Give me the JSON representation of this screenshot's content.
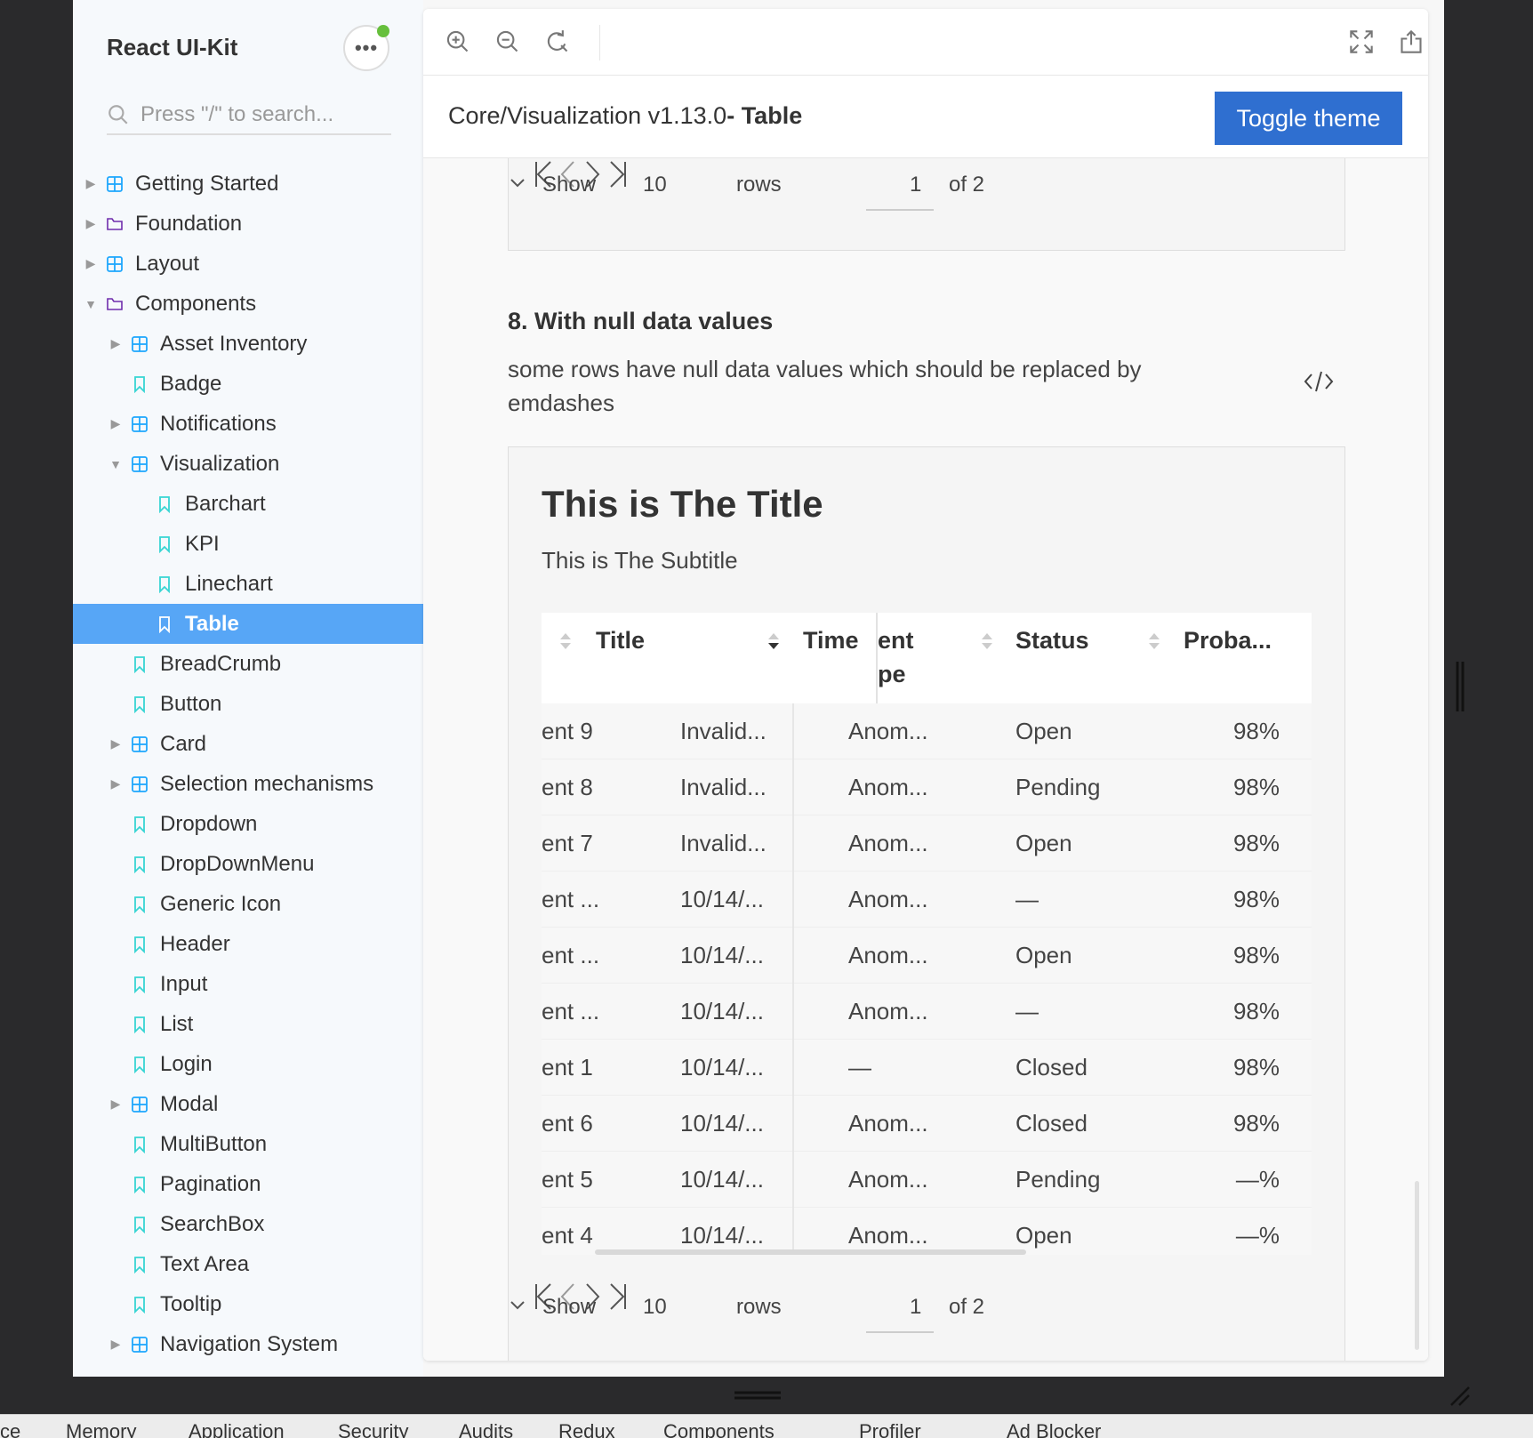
{
  "sidebar": {
    "brand": "React UI-Kit",
    "menu_button": "•••",
    "search_placeholder": "Press \"/\" to search...",
    "items": [
      {
        "label": "Getting Started",
        "icon": "component-icon",
        "level": 0,
        "expandable": true,
        "expanded": false
      },
      {
        "label": "Foundation",
        "icon": "folder-icon",
        "level": 0,
        "expandable": true,
        "expanded": false
      },
      {
        "label": "Layout",
        "icon": "component-icon",
        "level": 0,
        "expandable": true,
        "expanded": false
      },
      {
        "label": "Components",
        "icon": "folder-icon",
        "level": 0,
        "expandable": true,
        "expanded": true
      },
      {
        "label": "Asset Inventory",
        "icon": "component-icon",
        "level": 1,
        "expandable": true,
        "expanded": false
      },
      {
        "label": "Badge",
        "icon": "bookmark-icon",
        "level": 1,
        "expandable": false
      },
      {
        "label": "Notifications",
        "icon": "component-icon",
        "level": 1,
        "expandable": true,
        "expanded": false
      },
      {
        "label": "Visualization",
        "icon": "component-icon",
        "level": 1,
        "expandable": true,
        "expanded": true
      },
      {
        "label": "Barchart",
        "icon": "bookmark-icon",
        "level": 2,
        "expandable": false
      },
      {
        "label": "KPI",
        "icon": "bookmark-icon",
        "level": 2,
        "expandable": false
      },
      {
        "label": "Linechart",
        "icon": "bookmark-icon",
        "level": 2,
        "expandable": false
      },
      {
        "label": "Table",
        "icon": "bookmark-icon",
        "level": 2,
        "expandable": false,
        "active": true
      },
      {
        "label": "BreadCrumb",
        "icon": "bookmark-icon",
        "level": 1,
        "expandable": false
      },
      {
        "label": "Button",
        "icon": "bookmark-icon",
        "level": 1,
        "expandable": false
      },
      {
        "label": "Card",
        "icon": "component-icon",
        "level": 1,
        "expandable": true,
        "expanded": false
      },
      {
        "label": "Selection mechanisms",
        "icon": "component-icon",
        "level": 1,
        "expandable": true,
        "expanded": false
      },
      {
        "label": "Dropdown",
        "icon": "bookmark-icon",
        "level": 1,
        "expandable": false
      },
      {
        "label": "DropDownMenu",
        "icon": "bookmark-icon",
        "level": 1,
        "expandable": false
      },
      {
        "label": "Generic Icon",
        "icon": "bookmark-icon",
        "level": 1,
        "expandable": false
      },
      {
        "label": "Header",
        "icon": "bookmark-icon",
        "level": 1,
        "expandable": false
      },
      {
        "label": "Input",
        "icon": "bookmark-icon",
        "level": 1,
        "expandable": false
      },
      {
        "label": "List",
        "icon": "bookmark-icon",
        "level": 1,
        "expandable": false
      },
      {
        "label": "Login",
        "icon": "bookmark-icon",
        "level": 1,
        "expandable": false
      },
      {
        "label": "Modal",
        "icon": "component-icon",
        "level": 1,
        "expandable": true,
        "expanded": false
      },
      {
        "label": "MultiButton",
        "icon": "bookmark-icon",
        "level": 1,
        "expandable": false
      },
      {
        "label": "Pagination",
        "icon": "bookmark-icon",
        "level": 1,
        "expandable": false
      },
      {
        "label": "SearchBox",
        "icon": "bookmark-icon",
        "level": 1,
        "expandable": false
      },
      {
        "label": "Text Area",
        "icon": "bookmark-icon",
        "level": 1,
        "expandable": false
      },
      {
        "label": "Tooltip",
        "icon": "bookmark-icon",
        "level": 1,
        "expandable": false
      },
      {
        "label": "Navigation System",
        "icon": "component-icon",
        "level": 1,
        "expandable": true,
        "expanded": false
      }
    ]
  },
  "toolbar": {
    "left_icons": [
      "zoom-in-icon",
      "zoom-out-icon",
      "reset-zoom-icon"
    ],
    "right_icons": [
      "fullscreen-icon",
      "share-icon",
      "copy-icon"
    ]
  },
  "header": {
    "path": "Core/Visualization v1.13.0",
    "current": "- Table",
    "toggle_theme": "Toggle theme"
  },
  "top_pager": {
    "show": "Show",
    "page_size": "10",
    "rows": "rows",
    "page": "1",
    "of": "of 2"
  },
  "section": {
    "title": "8. With null data values",
    "description": "some rows have null data values which should be replaced by emdashes"
  },
  "card": {
    "title": "This is The Title",
    "subtitle": "This is The Subtitle"
  },
  "table": {
    "columns": [
      {
        "label": "Title",
        "sort": "none"
      },
      {
        "label": "Time",
        "sort": "descending"
      },
      {
        "label": "ent",
        "label2": "pe",
        "sort": "none"
      },
      {
        "label": "Status",
        "sort": "none"
      },
      {
        "label": "Proba...",
        "sort": "none"
      }
    ],
    "rows": [
      [
        "ent 9",
        "Invalid...",
        "Anom...",
        "Open",
        "98%"
      ],
      [
        "ent 8",
        "Invalid...",
        "Anom...",
        "Pending",
        "98%"
      ],
      [
        "ent 7",
        "Invalid...",
        "Anom...",
        "Open",
        "98%"
      ],
      [
        "ent ...",
        "10/14/...",
        "Anom...",
        "—",
        "98%"
      ],
      [
        "ent ...",
        "10/14/...",
        "Anom...",
        "Open",
        "98%"
      ],
      [
        "ent ...",
        "10/14/...",
        "Anom...",
        "—",
        "98%"
      ],
      [
        "ent 1",
        "10/14/...",
        "—",
        "Closed",
        "98%"
      ],
      [
        "ent 6",
        "10/14/...",
        "Anom...",
        "Closed",
        "98%"
      ],
      [
        "ent 5",
        "10/14/...",
        "Anom...",
        "Pending",
        "—%"
      ],
      [
        "ent 4",
        "10/14/...",
        "Anom...",
        "Open",
        "—%"
      ]
    ]
  },
  "bottom_pager": {
    "show": "Show",
    "page_size": "10",
    "rows": "rows",
    "page": "1",
    "of": "of 2"
  },
  "devtools_tabs": [
    "ce",
    "Memory",
    "Application",
    "Security",
    "Audits",
    "Redux",
    "Components",
    "Profiler",
    "Ad Blocker"
  ],
  "colors": {
    "active_nav": "#57a6f6",
    "toggle_button": "#2f6fd0",
    "status_dot": "#66bf3c",
    "component_icon": "#1ea7fd",
    "folder_icon": "#6f2cac",
    "bookmark_icon": "#37d5d3"
  }
}
